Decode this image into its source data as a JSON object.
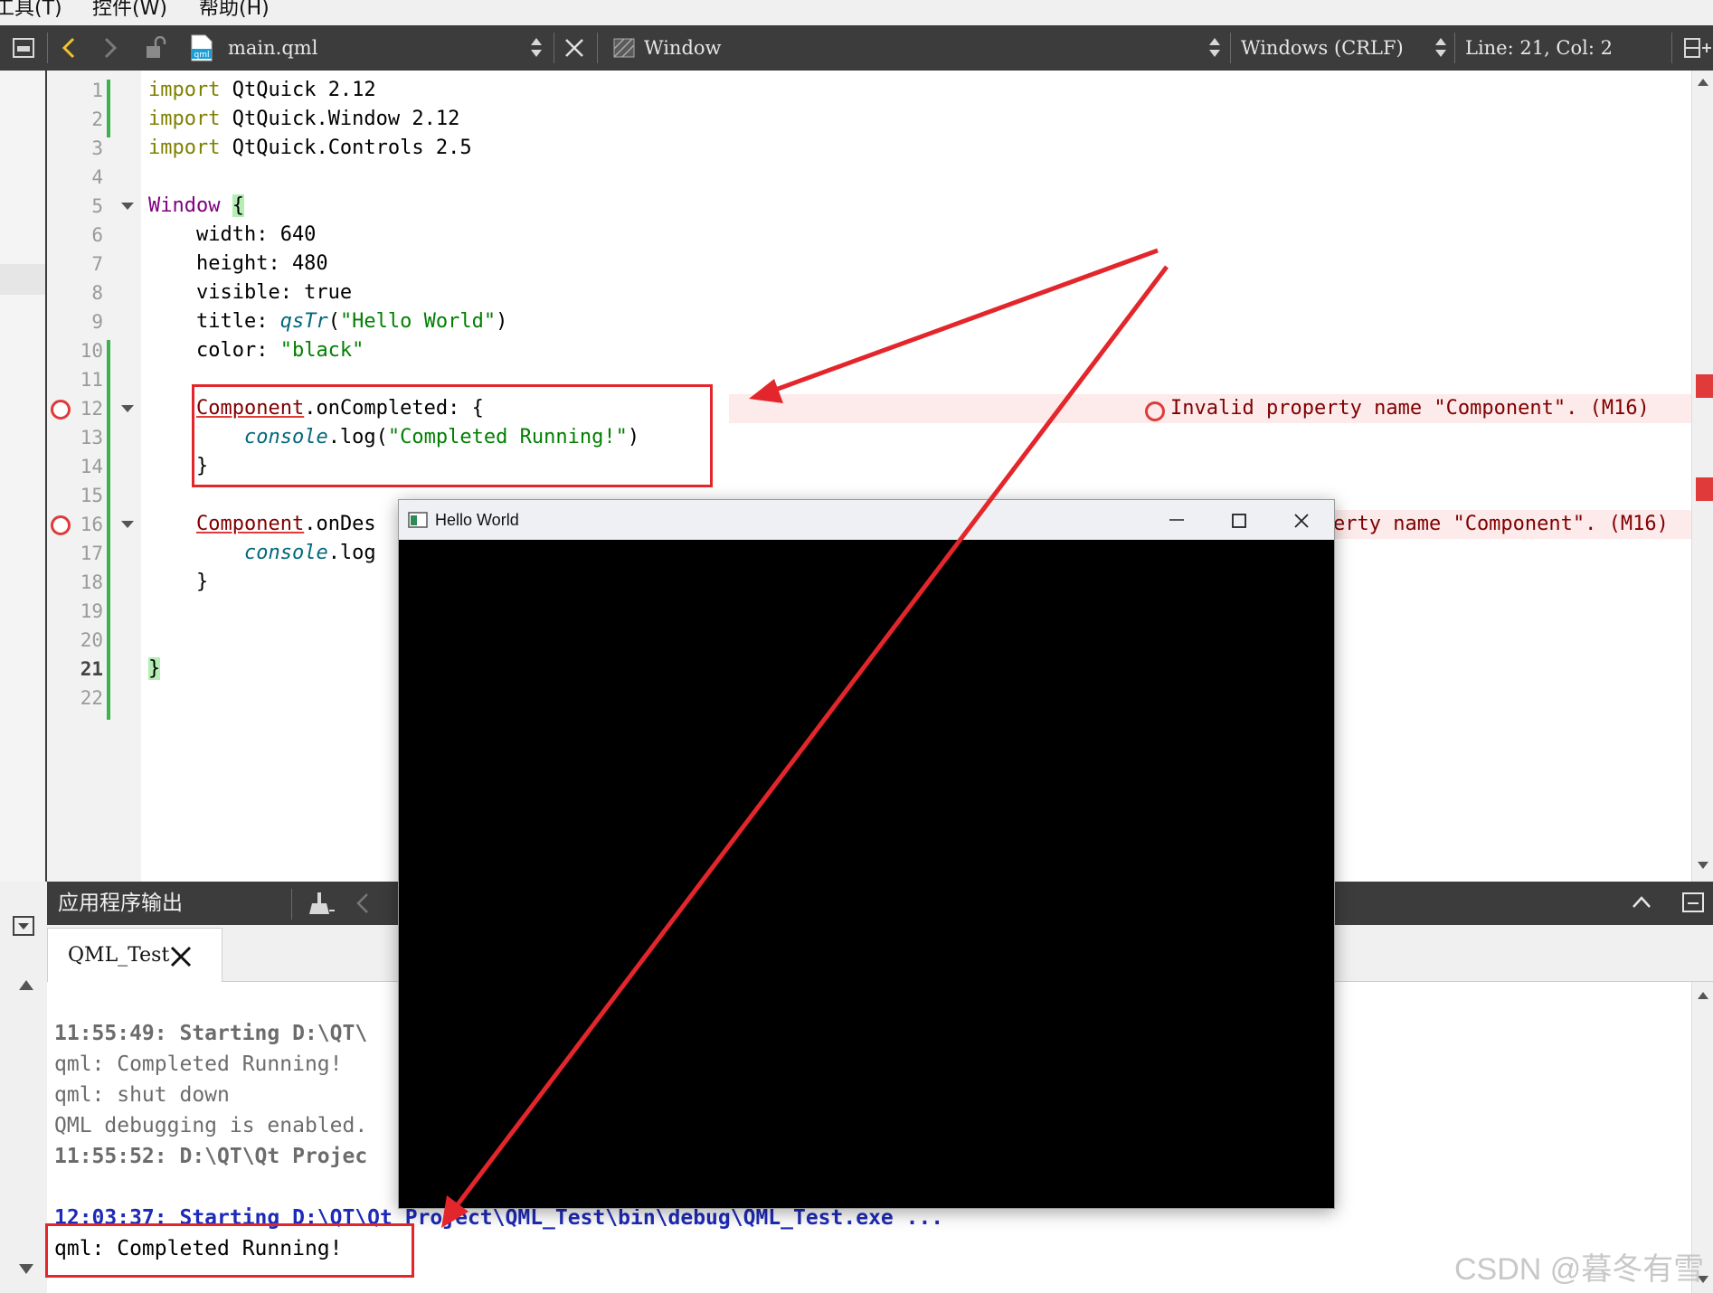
{
  "menubar": {
    "items": [
      "工具(T)",
      "控件(W)",
      "帮助(H)"
    ]
  },
  "toolbar": {
    "file_name": "main.qml",
    "symbol": "Window",
    "line_ending": "Windows (CRLF)",
    "position": "Line: 21, Col: 2"
  },
  "editor": {
    "line_numbers": [
      "1",
      "2",
      "3",
      "4",
      "5",
      "6",
      "7",
      "8",
      "9",
      "10",
      "11",
      "12",
      "13",
      "14",
      "15",
      "16",
      "17",
      "18",
      "19",
      "20",
      "21",
      "22"
    ],
    "lines": {
      "l1": [
        "import",
        " QtQuick 2.12"
      ],
      "l2": [
        "import",
        " QtQuick.Window 2.12"
      ],
      "l3": [
        "import",
        " QtQuick.Controls 2.5"
      ],
      "l5": [
        "Window",
        " ",
        "{"
      ],
      "l6": "    width: 640",
      "l7": "    height: 480",
      "l8": "    visible: true",
      "l9": [
        "    title: ",
        "qsTr",
        "(",
        "\"Hello World\"",
        ")"
      ],
      "l10": [
        "    color: ",
        "\"black\""
      ],
      "l12": [
        "    ",
        "Component",
        ".onCompleted: {"
      ],
      "l13": [
        "        ",
        "console",
        ".log(",
        "\"Completed Running!\"",
        ")"
      ],
      "l14": "    }",
      "l16": [
        "    ",
        "Component",
        ".onDes"
      ],
      "l17": [
        "        ",
        "console",
        ".log"
      ],
      "l18": "    }",
      "l21": "}"
    },
    "error_1": "Invalid property name \"Component\". (M16)",
    "error_2_partial": "erty name \"Component\". (M16)"
  },
  "output": {
    "title": "应用程序输出",
    "tab_label": "QML_Test",
    "lines": [
      "11:55:49: Starting D:\\QT\\",
      "qml: Completed Running!",
      "qml: shut down",
      "QML debugging is enabled.",
      "11:55:52: D:\\QT\\Qt Projec",
      "12:03:37: Starting D:\\QT\\Qt Project\\QML_Test\\bin\\debug\\QML_Test.exe ...",
      "qml: Completed Running!"
    ]
  },
  "window": {
    "title": "Hello World"
  },
  "watermark": "CSDN @暮冬有雪",
  "colors": {
    "annotation_red": "#e3262b",
    "window_background": "#000000",
    "toolbar_bg": "#3c3c3c"
  }
}
